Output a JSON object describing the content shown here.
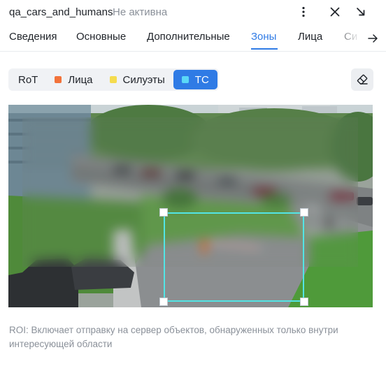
{
  "header": {
    "title": "qa_cars_and_humans",
    "status": "Не активна",
    "icons": [
      "more-vertical-icon",
      "close-icon",
      "collapse-arrow-icon"
    ]
  },
  "tabs": [
    {
      "label": "Сведения",
      "active": false
    },
    {
      "label": "Основные",
      "active": false
    },
    {
      "label": "Дополнительные",
      "active": false
    },
    {
      "label": "Зоны",
      "active": true
    },
    {
      "label": "Лица",
      "active": false
    },
    {
      "label": "Си",
      "active": false
    }
  ],
  "zones": {
    "buttons": [
      {
        "label": "RoT",
        "color": null,
        "active": false
      },
      {
        "label": "Лица",
        "color": "#f2723a",
        "active": false
      },
      {
        "label": "Силуэты",
        "color": "#f5dc4e",
        "active": false
      },
      {
        "label": "ТС",
        "color": "#5ad8f7",
        "active": true
      }
    ],
    "eraser_icon": "eraser-icon"
  },
  "colors": {
    "accent": "#2f7be5",
    "roi_outline": "#52e5e5"
  },
  "hint": "ROI: Включает отправку на сервер объектов, обнаруженных только внутри интересующей области"
}
